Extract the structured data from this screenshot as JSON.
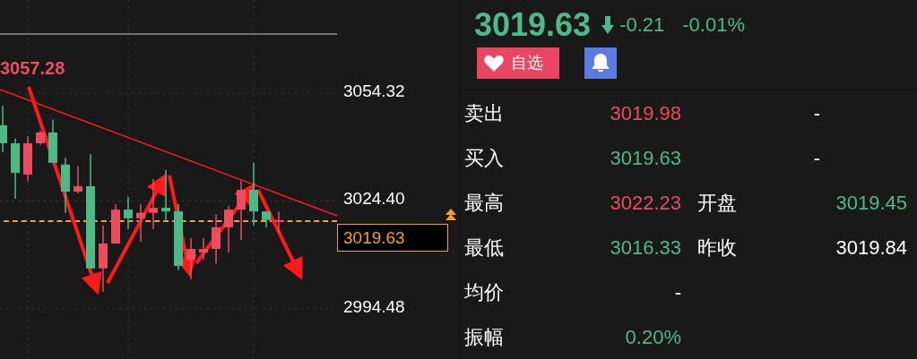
{
  "chart": {
    "high_marker": "3057.28",
    "current_price_tag": "3019.63",
    "chart_data": {
      "type": "candlestick",
      "ohlc": [
        [
          3045.4,
          3050.8,
          3037.9,
          3040.4
        ],
        [
          3040.4,
          3041.7,
          3025.0,
          3032.2
        ],
        [
          3031.7,
          3042.4,
          3030.0,
          3040.4
        ],
        [
          3040.4,
          3043.9,
          3039.9,
          3043.4
        ],
        [
          3043.4,
          3046.9,
          3035.0,
          3035.0
        ],
        [
          3034.5,
          3036.4,
          3021.1,
          3027.0
        ],
        [
          3027.0,
          3034.0,
          3026.5,
          3028.5
        ],
        [
          3028.5,
          3037.4,
          3005.7,
          3005.7
        ],
        [
          3005.7,
          3017.6,
          2999.2,
          3012.6
        ],
        [
          3012.6,
          3023.5,
          3012.6,
          3022.0
        ],
        [
          3022.0,
          3025.5,
          3016.6,
          3019.6
        ],
        [
          3019.6,
          3023.5,
          3013.1,
          3021.1
        ],
        [
          3021.1,
          3030.5,
          3016.6,
          3022.5
        ],
        [
          3022.5,
          3033.0,
          3019.1,
          3021.5
        ],
        [
          3021.5,
          3023.5,
          3005.2,
          3006.4
        ],
        [
          3008.1,
          3014.1,
          3002.7,
          3011.1
        ],
        [
          3010.1,
          3014.1,
          3008.1,
          3011.1
        ],
        [
          3011.1,
          3020.6,
          3007.1,
          3017.1
        ],
        [
          3017.1,
          3023.0,
          3010.1,
          3022.0
        ],
        [
          3022.0,
          3030.0,
          3013.6,
          3027.5
        ],
        [
          3027.5,
          3035.0,
          3017.6,
          3021.5
        ],
        [
          3021.5,
          3021.5,
          3017.1,
          3019.1
        ],
        [
          3018.6,
          3021.5,
          3015.6,
          3019.1
        ]
      ],
      "grid": true,
      "ylim": [
        2980.57,
        3080.14
      ],
      "yticks": [
        {
          "value": 3054.32,
          "label": "3054.32"
        },
        {
          "value": 3024.4,
          "label": "3024.40"
        },
        {
          "value": 2994.48,
          "label": "2994.48"
        }
      ]
    }
  },
  "quote": {
    "price": "3019.63",
    "change": "-0.21",
    "change_percent": "-0.01%"
  },
  "buttons": [
    {
      "kind": "watchlist",
      "label": "自选"
    },
    {
      "kind": "alert"
    }
  ],
  "stats": [
    {
      "label": "卖出",
      "value": {
        "text": "3019.98",
        "color": "#ea4d5e"
      },
      "value_2": {
        "text": "-",
        "color": "#ffffff"
      }
    },
    {
      "label": "买入",
      "value": {
        "text": "3019.63",
        "color": "#4fb887"
      },
      "value_2": {
        "text": "-",
        "color": "#ffffff"
      }
    },
    {
      "label": "最高",
      "value": {
        "text": "3022.23",
        "color": "#ea4d5e"
      },
      "label_2": "开盘",
      "value_2": {
        "text": "3019.45",
        "color": "#4fb887"
      }
    },
    {
      "label": "最低",
      "value": {
        "text": "3016.33",
        "color": "#4fb887"
      },
      "label_2": "昨收",
      "value_2": {
        "text": "3019.84",
        "color": "#ffffff"
      }
    },
    {
      "label": "均价",
      "value": {
        "text": "-",
        "color": "#ffffff"
      }
    },
    {
      "label": "振幅",
      "value": {
        "text": "0.20%",
        "color": "#4fb887"
      }
    }
  ]
}
